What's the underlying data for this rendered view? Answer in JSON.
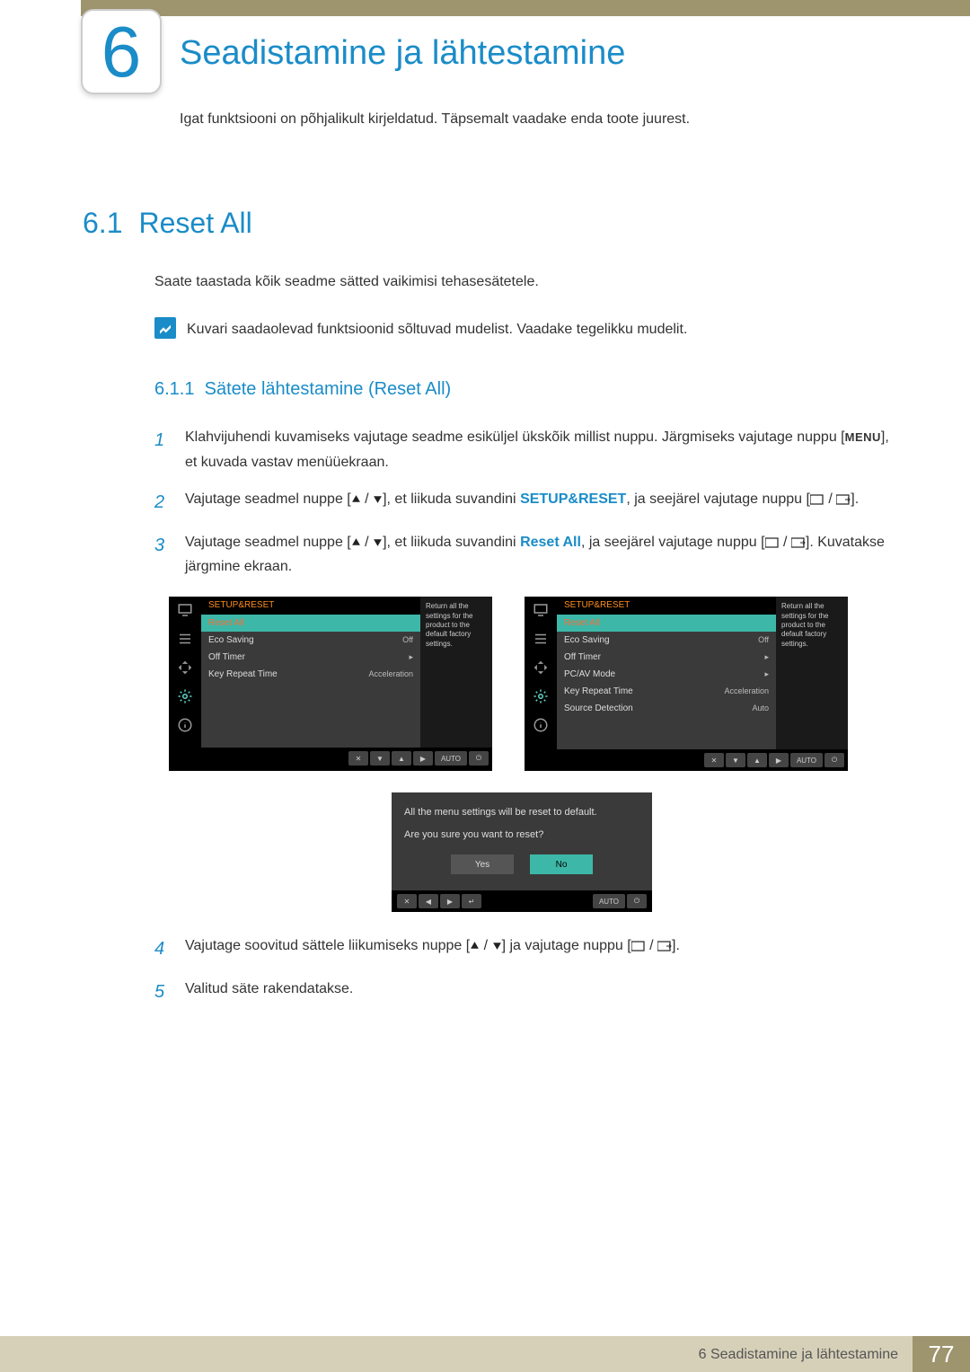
{
  "chapter": {
    "number": "6",
    "title": "Seadistamine ja lähtestamine",
    "description": "Igat funktsiooni on põhjalikult kirjeldatud. Täpsemalt vaadake enda toote juurest."
  },
  "section": {
    "number": "6.1",
    "title": "Reset All",
    "intro": "Saate taastada kõik seadme sätted vaikimisi tehasesätetele.",
    "note": "Kuvari saadaolevad funktsioonid sõltuvad mudelist. Vaadake tegelikku mudelit."
  },
  "subsection": {
    "number": "6.1.1",
    "title": "Sätete lähtestamine (Reset All)"
  },
  "steps": {
    "s1a": "Klahvijuhendi kuvamiseks vajutage seadme esiküljel ükskõik millist nuppu. Järgmiseks vajutage nuppu [",
    "s1b": "], et kuvada vastav menüüekraan.",
    "menu_label": "MENU",
    "s2a": "Vajutage seadmel nuppe [",
    "s2b": "], et liikuda suvandini ",
    "s2c": ", ja seejärel vajutage nuppu [",
    "s2d": "].",
    "setup_reset": "SETUP&RESET",
    "s3a": "Vajutage seadmel nuppe [",
    "s3b": "], et liikuda suvandini ",
    "s3c": ", ja seejärel vajutage nuppu [",
    "s3d": "]. Kuvatakse järgmine ekraan.",
    "reset_all": "Reset All",
    "s4a": "Vajutage soovitud sättele liikumiseks nuppe [",
    "s4b": "] ja vajutage nuppu [",
    "s4c": "].",
    "s5": "Valitud säte rakendatakse."
  },
  "osd1": {
    "header": "SETUP&RESET",
    "desc": "Return all the settings for the product to the default factory settings.",
    "items": [
      {
        "label": "Reset All",
        "value": ""
      },
      {
        "label": "Eco Saving",
        "value": "Off"
      },
      {
        "label": "Off Timer",
        "value": "▸"
      },
      {
        "label": "Key Repeat Time",
        "value": "Acceleration"
      }
    ],
    "nav_auto": "AUTO"
  },
  "osd2": {
    "header": "SETUP&RESET",
    "desc": "Return all the settings for the product to the default factory settings.",
    "items": [
      {
        "label": "Reset All",
        "value": ""
      },
      {
        "label": "Eco Saving",
        "value": "Off"
      },
      {
        "label": "Off Timer",
        "value": "▸"
      },
      {
        "label": "PC/AV Mode",
        "value": "▸"
      },
      {
        "label": "Key Repeat Time",
        "value": "Acceleration"
      },
      {
        "label": "Source Detection",
        "value": "Auto"
      }
    ],
    "nav_auto": "AUTO"
  },
  "confirm": {
    "line1": "All the menu settings will be reset to default.",
    "line2": "Are you sure you want to reset?",
    "yes": "Yes",
    "no": "No",
    "nav_auto": "AUTO"
  },
  "footer": {
    "label": "6 Seadistamine ja lähtestamine",
    "page": "77"
  }
}
